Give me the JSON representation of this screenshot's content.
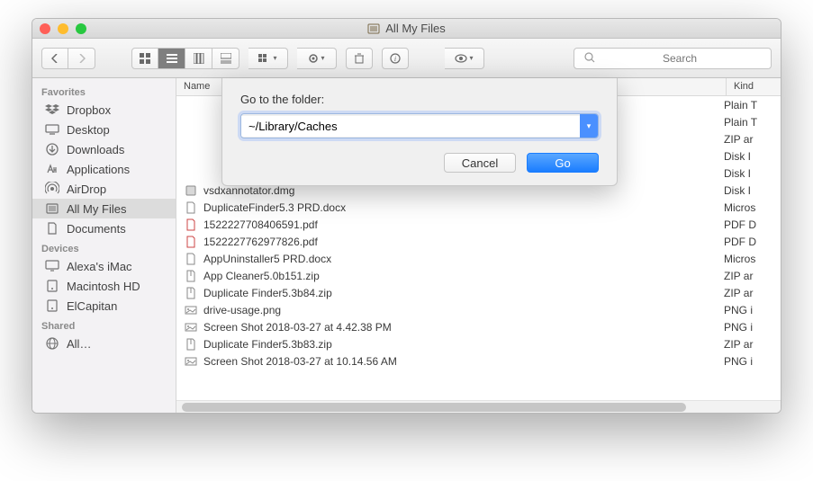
{
  "window": {
    "title": "All My Files"
  },
  "toolbar": {
    "search_placeholder": "Search"
  },
  "sidebar": {
    "sections": [
      {
        "header": "Favorites",
        "items": [
          {
            "icon": "dropbox",
            "label": "Dropbox"
          },
          {
            "icon": "desktop",
            "label": "Desktop"
          },
          {
            "icon": "downloads",
            "label": "Downloads"
          },
          {
            "icon": "apps",
            "label": "Applications"
          },
          {
            "icon": "airdrop",
            "label": "AirDrop"
          },
          {
            "icon": "allfiles",
            "label": "All My Files",
            "active": true
          },
          {
            "icon": "documents",
            "label": "Documents"
          }
        ]
      },
      {
        "header": "Devices",
        "items": [
          {
            "icon": "imac",
            "label": "Alexa's iMac"
          },
          {
            "icon": "hdd",
            "label": "Macintosh HD"
          },
          {
            "icon": "hdd",
            "label": "ElCapitan"
          }
        ]
      },
      {
        "header": "Shared",
        "items": [
          {
            "icon": "globe",
            "label": "All…"
          }
        ]
      }
    ]
  },
  "columns": {
    "name": "Name",
    "kind": "Kind"
  },
  "files": [
    {
      "icon": "",
      "name": "",
      "kind": "Plain T"
    },
    {
      "icon": "",
      "name": "",
      "kind": "Plain T"
    },
    {
      "icon": "",
      "name": "",
      "kind": "ZIP ar"
    },
    {
      "icon": "",
      "name": "",
      "kind": "Disk I"
    },
    {
      "icon": "",
      "name": "",
      "kind": "Disk I"
    },
    {
      "icon": "dmg",
      "name": "vsdxannotator.dmg",
      "kind": "Disk I"
    },
    {
      "icon": "docx",
      "name": "DuplicateFinder5.3 PRD.docx",
      "kind": "Micros"
    },
    {
      "icon": "pdf",
      "name": "1522227708406591.pdf",
      "kind": "PDF D"
    },
    {
      "icon": "pdf",
      "name": "1522227762977826.pdf",
      "kind": "PDF D"
    },
    {
      "icon": "docx",
      "name": "AppUninstaller5 PRD.docx",
      "kind": "Micros"
    },
    {
      "icon": "zip",
      "name": "App Cleaner5.0b151.zip",
      "kind": "ZIP ar"
    },
    {
      "icon": "zip",
      "name": "Duplicate Finder5.3b84.zip",
      "kind": "ZIP ar"
    },
    {
      "icon": "png",
      "name": "drive-usage.png",
      "kind": "PNG i"
    },
    {
      "icon": "png",
      "name": "Screen Shot 2018-03-27 at 4.42.38 PM",
      "kind": "PNG i"
    },
    {
      "icon": "zip",
      "name": "Duplicate Finder5.3b83.zip",
      "kind": "ZIP ar"
    },
    {
      "icon": "png",
      "name": "Screen Shot 2018-03-27 at 10.14.56 AM",
      "kind": "PNG i"
    }
  ],
  "dialog": {
    "label": "Go to the folder:",
    "value": "~/Library/Caches",
    "cancel": "Cancel",
    "go": "Go"
  }
}
